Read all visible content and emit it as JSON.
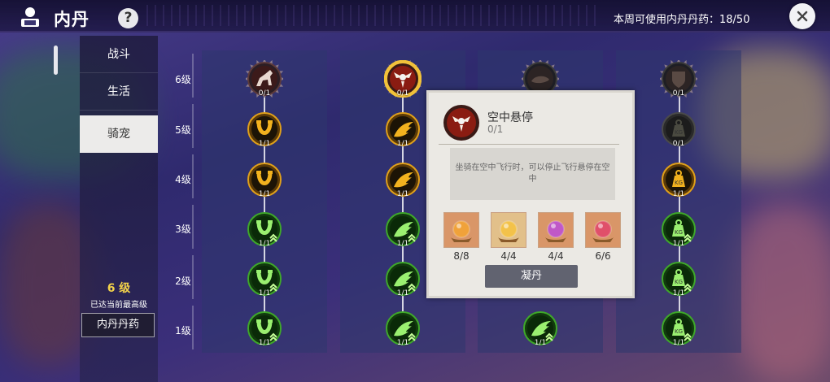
{
  "header": {
    "title": "内丹",
    "help_icon_glyph": "?",
    "weekly_label": "本周可使用内丹丹药：18/50"
  },
  "tabs": [
    {
      "label": "战斗",
      "active": false
    },
    {
      "label": "生活",
      "active": false
    },
    {
      "label": "骑宠",
      "active": true
    }
  ],
  "level_info": {
    "level": "6 级",
    "note": "已达当前最高级",
    "button_label": "内丹丹药"
  },
  "levels": [
    "6级",
    "5级",
    "4级",
    "3级",
    "2级",
    "1级"
  ],
  "columns": [
    {
      "nodes": [
        {
          "count": "0/1",
          "icon": "horse-icon",
          "state": "top"
        },
        {
          "count": "1/1",
          "icon": "horseshoe-icon",
          "state": "gold"
        },
        {
          "count": "1/1",
          "icon": "horseshoe-icon",
          "state": "gold"
        },
        {
          "count": "1/1",
          "icon": "horseshoe-up-icon",
          "state": "green"
        },
        {
          "count": "1/1",
          "icon": "horseshoe-up-icon",
          "state": "green"
        },
        {
          "count": "1/1",
          "icon": "horseshoe-up-icon",
          "state": "green"
        }
      ]
    },
    {
      "nodes": [
        {
          "count": "0/1",
          "icon": "hover-wing-icon",
          "state": "top-selected"
        },
        {
          "count": "1/1",
          "icon": "wing-icon",
          "state": "gold"
        },
        {
          "count": "1/1",
          "icon": "wing-icon",
          "state": "gold"
        },
        {
          "count": "1/1",
          "icon": "wing-up-icon",
          "state": "green"
        },
        {
          "count": "1/1",
          "icon": "wing-up-icon",
          "state": "green"
        },
        {
          "count": "1/1",
          "icon": "wing-up-icon",
          "state": "green"
        }
      ]
    },
    {
      "nodes": [
        {
          "count": "",
          "icon": "saddle-icon",
          "state": "top-locked"
        },
        {
          "count": "1/1",
          "icon": "feather-icon",
          "state": "green"
        }
      ]
    },
    {
      "nodes": [
        {
          "count": "0/1",
          "icon": "shield-icon",
          "state": "top-locked"
        },
        {
          "count": "0/1",
          "icon": "weight-icon",
          "state": "locked"
        },
        {
          "count": "1/1",
          "icon": "weight-icon",
          "state": "gold"
        },
        {
          "count": "1/1",
          "icon": "weight-up-icon",
          "state": "green"
        },
        {
          "count": "1/1",
          "icon": "weight-up-icon",
          "state": "green"
        },
        {
          "count": "1/1",
          "icon": "weight-up-icon",
          "state": "green"
        }
      ]
    }
  ],
  "node_weight_label": "KG",
  "popup": {
    "title": "空中悬停",
    "count": "0/1",
    "description": "坐骑在空中飞行时，可以停止飞行悬停在空中",
    "materials": [
      {
        "count": "8/8",
        "color": "#f0a23a"
      },
      {
        "count": "4/4",
        "color": "#f3c24a"
      },
      {
        "count": "4/4",
        "color": "#c058c8"
      },
      {
        "count": "6/6",
        "color": "#e0506a"
      }
    ],
    "button_label": "凝丹"
  },
  "colors": {
    "gold_node": "#c98a10",
    "green_node": "#2a8a1e",
    "selected_ring": "#f2c23a",
    "popup_bg": "#ebe9e4"
  }
}
